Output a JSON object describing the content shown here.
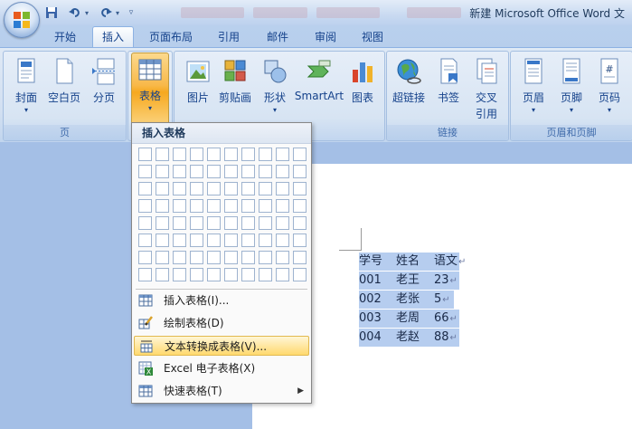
{
  "window": {
    "title": "新建 Microsoft Office Word 文"
  },
  "quick_access": {
    "save_icon": "save-icon",
    "undo_icon": "undo-icon",
    "redo_icon": "redo-icon"
  },
  "tabs": [
    {
      "label": "开始",
      "active": false
    },
    {
      "label": "插入",
      "active": true
    },
    {
      "label": "页面布局",
      "active": false
    },
    {
      "label": "引用",
      "active": false
    },
    {
      "label": "邮件",
      "active": false
    },
    {
      "label": "审阅",
      "active": false
    },
    {
      "label": "视图",
      "active": false
    }
  ],
  "ribbon": {
    "pages_group": {
      "label": "页",
      "buttons": [
        {
          "label": "封面",
          "icon": "cover-page-icon"
        },
        {
          "label": "空白页",
          "icon": "blank-page-icon"
        },
        {
          "label": "分页",
          "icon": "page-break-icon"
        }
      ]
    },
    "table_group": {
      "button_label": "表格",
      "icon": "table-icon"
    },
    "illustrations_group": {
      "buttons": [
        {
          "label": "图片",
          "icon": "picture-icon"
        },
        {
          "label": "剪贴画",
          "icon": "clip-art-icon"
        },
        {
          "label": "形状",
          "icon": "shapes-icon"
        },
        {
          "label": "SmartArt",
          "icon": "smartart-icon"
        },
        {
          "label": "图表",
          "icon": "chart-icon"
        }
      ]
    },
    "links_group": {
      "label": "链接",
      "buttons": [
        {
          "label": "超链接",
          "icon": "hyperlink-icon"
        },
        {
          "label": "书签",
          "icon": "bookmark-icon"
        },
        {
          "label": "交叉",
          "label2": "引用",
          "icon": "cross-reference-icon"
        }
      ]
    },
    "header_footer_group": {
      "label": "页眉和页脚",
      "buttons": [
        {
          "label": "页眉",
          "icon": "header-icon"
        },
        {
          "label": "页脚",
          "icon": "footer-icon"
        },
        {
          "label": "页码",
          "icon": "page-number-icon"
        }
      ]
    }
  },
  "table_menu": {
    "header": "插入表格",
    "grid_cols": 10,
    "grid_rows": 8,
    "items": [
      {
        "label": "插入表格(I)...",
        "icon": "insert-table-icon",
        "hover": false,
        "submenu": false
      },
      {
        "label": "绘制表格(D)",
        "icon": "draw-table-icon",
        "hover": false,
        "submenu": false
      },
      {
        "label": "文本转换成表格(V)...",
        "icon": "convert-text-to-table-icon",
        "hover": true,
        "submenu": false
      },
      {
        "label": "Excel 电子表格(X)",
        "icon": "excel-spreadsheet-icon",
        "hover": false,
        "submenu": false
      },
      {
        "label": "快速表格(T)",
        "icon": "quick-tables-icon",
        "hover": false,
        "submenu": true
      }
    ]
  },
  "document": {
    "selected_text_rows": [
      [
        "学号",
        "姓名",
        "语文"
      ],
      [
        "001",
        "老王",
        "23"
      ],
      [
        "002",
        "老张",
        "5"
      ],
      [
        "003",
        "老周",
        "66"
      ],
      [
        "004",
        "老赵",
        "88"
      ]
    ],
    "paragraph_mark": "↵",
    "selection_color": "#b6cdef"
  }
}
